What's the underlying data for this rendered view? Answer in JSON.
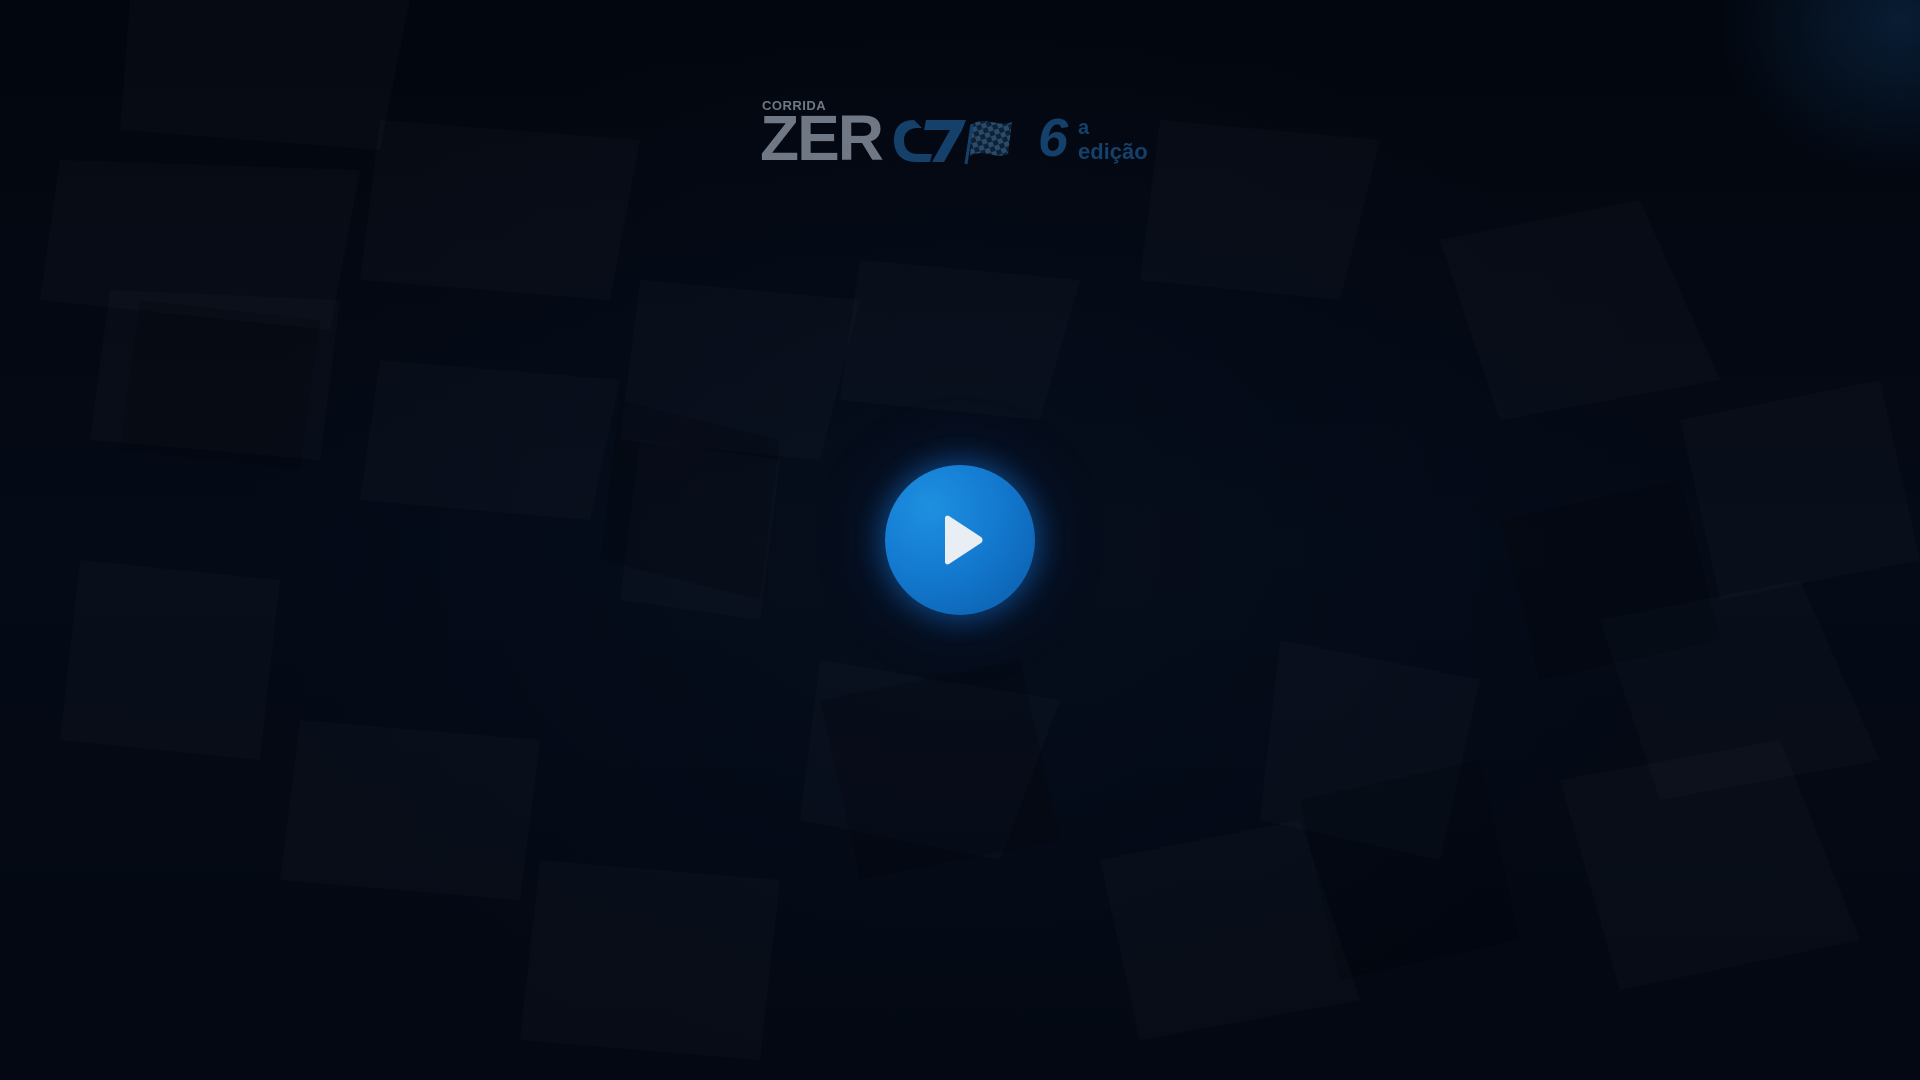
{
  "logo": {
    "kicker": "CORRIDA",
    "word": "ZER",
    "edition_number": "6",
    "edition_sup": "a",
    "edition_word": "edição",
    "colors": {
      "gray": "#6f7884",
      "blue": "#14406a"
    }
  },
  "player": {
    "play_icon": "play-icon",
    "button_color": "#137ad0"
  },
  "background": {
    "base_color": "#030812"
  }
}
